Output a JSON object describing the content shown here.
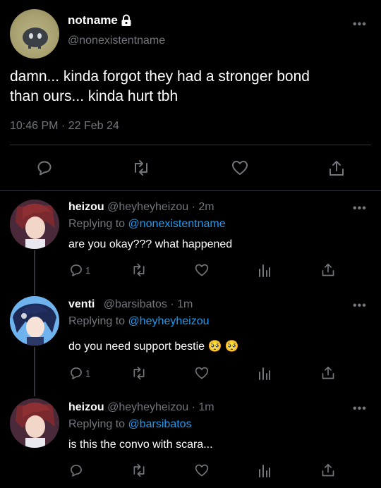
{
  "main_tweet": {
    "display_name": "notname",
    "handle": "@nonexistentname",
    "text_line1": "damn... kinda forgot they had a stronger bond",
    "text_line2": "than ours... kinda hurt tbh",
    "timestamp": "10:46 PM · 22 Feb 24",
    "more_glyph": "•••"
  },
  "replies": [
    {
      "display_name": "heizou",
      "handle": "@heyheyheizou",
      "time": "· 2m",
      "replying_prefix": "Replying to",
      "replying_to": "@nonexistentname",
      "text": "are you okay??? what happened",
      "reply_count": "1",
      "more_glyph": "•••"
    },
    {
      "display_name": "venti",
      "handle": "@barsibatos",
      "time": "· 1m",
      "replying_prefix": "Replying to",
      "replying_to": "@heyheyheizou",
      "text": "do you need support bestie 🥺 🥺",
      "reply_count": "1",
      "more_glyph": "•••"
    },
    {
      "display_name": "heizou",
      "handle": "@heyheyheizou",
      "time": "· 1m",
      "replying_prefix": "Replying to",
      "replying_to": "@barsibatos",
      "text": "is this the convo with scara...",
      "reply_count": "",
      "more_glyph": "•••"
    }
  ],
  "icons": [
    "lock-icon",
    "reply-icon",
    "retweet-icon",
    "like-icon",
    "views-icon",
    "share-icon",
    "more-icon"
  ],
  "colors": {
    "background": "#000000",
    "text": "#e7e9ea",
    "secondary": "#71767b",
    "link": "#1d9bf0",
    "divider": "#2f3336"
  }
}
